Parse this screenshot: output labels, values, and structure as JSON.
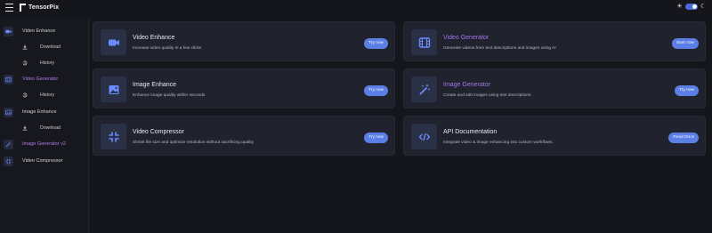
{
  "app": {
    "title": "TensorPix"
  },
  "colors": {
    "accent": "#5c7fe6",
    "active_nav": "#b27cf0",
    "card_bg": "#20232d",
    "page_bg": "#15161b"
  },
  "sidebar": {
    "items": [
      {
        "label": "Video Enhance",
        "icon": "video-camera-icon",
        "active": false
      },
      {
        "label": "Download",
        "icon": "download-icon",
        "sub": true
      },
      {
        "label": "History",
        "icon": "history-icon",
        "sub": true
      },
      {
        "label": "Video Generator",
        "icon": "film-icon",
        "active": true
      },
      {
        "label": "History",
        "icon": "history-icon",
        "sub": true
      },
      {
        "label": "Image Enhance",
        "icon": "image-icon",
        "active": false
      },
      {
        "label": "Download",
        "icon": "download-icon",
        "sub": true
      },
      {
        "label": "Image Generator v2",
        "icon": "magic-wand-icon",
        "active": true
      },
      {
        "label": "Video Compressor",
        "icon": "compress-icon",
        "active": false
      }
    ]
  },
  "cards": [
    {
      "title": "Video Enhance",
      "desc": "Increase video quality in a few clicks",
      "button": "Try now",
      "icon": "video-camera-icon"
    },
    {
      "title": "Video Generator",
      "desc": "Generate videos from text descriptions and images using AI",
      "button": "Start now",
      "icon": "film-icon"
    },
    {
      "title": "Image Enhance",
      "desc": "Enhance image quality within seconds",
      "button": "Try now",
      "icon": "image-icon"
    },
    {
      "title": "Image Generator",
      "desc": "Create and edit images using text descriptions",
      "button": "Try now",
      "icon": "magic-wand-icon"
    },
    {
      "title": "Video Compressor",
      "desc": "Shrink file size and optimize resolution without sacrificing quality",
      "button": "Try now",
      "icon": "compress-icon"
    },
    {
      "title": "API Documentation",
      "desc": "Integrate video & image enhancing into custom workflows.",
      "button": "Read Docs",
      "icon": "code-icon"
    }
  ]
}
